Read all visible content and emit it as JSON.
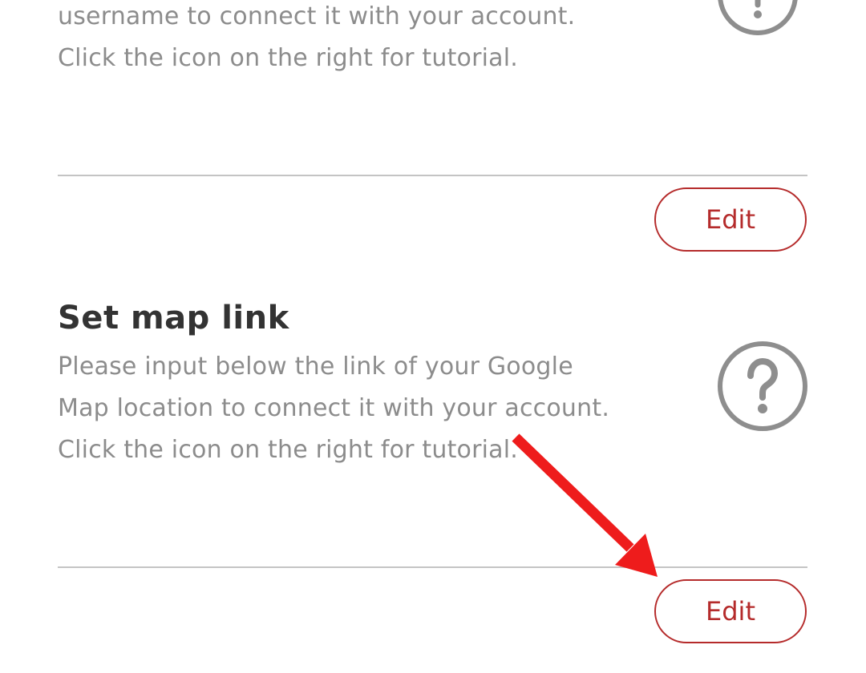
{
  "section_1": {
    "description_lines": [
      "username to connect it with your account.",
      "Click the icon on the right for tutorial."
    ],
    "edit_label": "Edit",
    "help_icon": "question-circle-icon"
  },
  "section_2": {
    "title": "Set map link",
    "description_lines": [
      "Please input below the link of your Google",
      "Map location to connect it with your account.",
      "Click the icon on the right for tutorial."
    ],
    "edit_label": "Edit",
    "help_icon": "question-circle-icon"
  },
  "annotation": {
    "icon": "red-arrow-icon",
    "color": "#ee1c1c"
  },
  "colors": {
    "accent": "#b52b2b",
    "body_text": "#8c8c8c",
    "title_text": "#333333",
    "divider": "#c4c4c4",
    "icon": "#8e8e8e"
  }
}
